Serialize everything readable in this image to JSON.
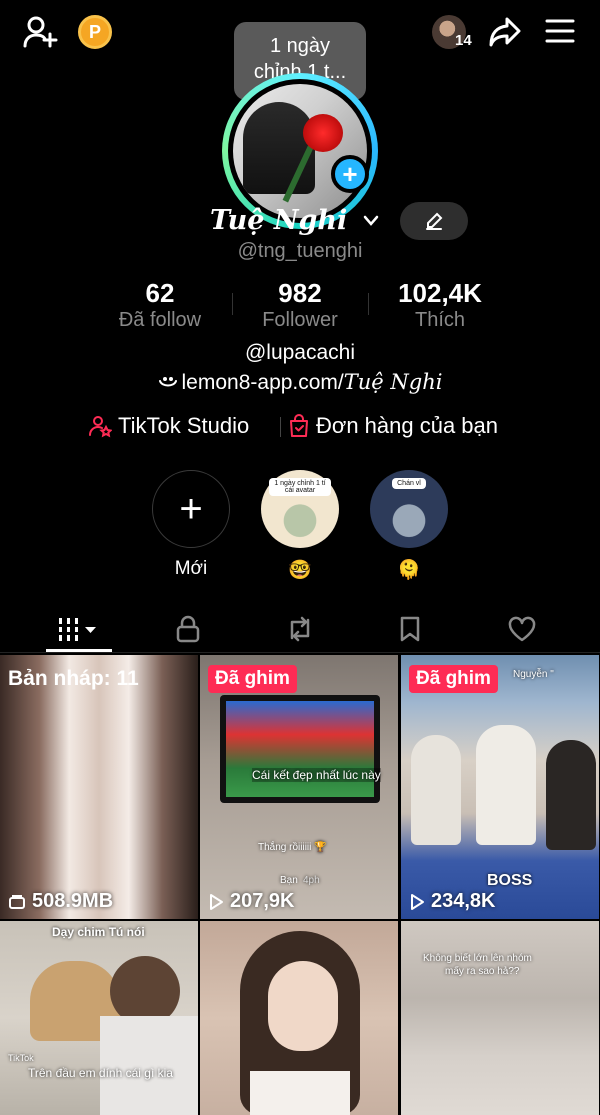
{
  "header": {
    "coin_letter": "P",
    "notif_count": "14",
    "tooltip_line1": "1 ngày",
    "tooltip_line2": "chỉnh 1 t..."
  },
  "profile": {
    "name": "Tuệ Nghi",
    "handle": "@tng_tuenghi",
    "stats": [
      {
        "value": "62",
        "label": "Đã follow"
      },
      {
        "value": "982",
        "label": "Follower"
      },
      {
        "value": "102,4K",
        "label": "Thích"
      }
    ],
    "bio_link1": "@lupacachi",
    "bio_link2_prefix": "lemon8-app.com/",
    "bio_link2_name": "Tuệ Nghi"
  },
  "tools": {
    "studio": "TikTok Studio",
    "orders": "Đơn hàng của bạn"
  },
  "highlights": [
    {
      "label": "Mới",
      "caption": ""
    },
    {
      "label": "🤓",
      "caption": "1 ngày chỉnh 1 tí cái avatar"
    },
    {
      "label": "🫠",
      "caption": "Chán vl"
    }
  ],
  "grid": [
    {
      "type": "draft",
      "label": "Bản nháp: 11",
      "stat": "508.9MB"
    },
    {
      "type": "pinned",
      "badge": "Đã ghim",
      "stat": "207,9K",
      "caption1": "Cái kết đẹp nhất lúc này",
      "caption2": "Thắng rồiiiiii 🏆",
      "caption3": "Bạn",
      "caption4": "4ph"
    },
    {
      "type": "pinned",
      "badge": "Đã ghim",
      "stat": "234,8K",
      "caption1": "Nguyễn \"",
      "caption2": "BOSS"
    },
    {
      "type": "video",
      "caption1": "Dạy chim Tú nói",
      "caption2": "Trên đầu em dính cái gì kia",
      "caption3": "TikTok"
    },
    {
      "type": "video"
    },
    {
      "type": "video",
      "caption1": "Không biết lớn lên nhóm",
      "caption2": "mấy ra sao hả??"
    }
  ],
  "colors": {
    "accent": "#fe2c55",
    "ring_start": "#5ff0ff",
    "ring_end": "#7ff6a0",
    "add_button": "#25b6ff",
    "coin": "#f5a623"
  }
}
